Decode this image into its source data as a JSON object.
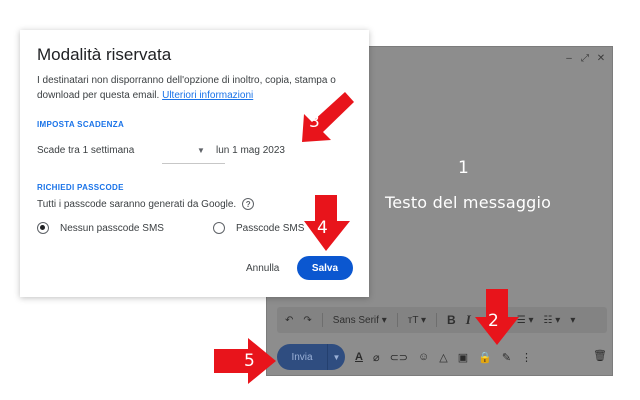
{
  "dialog": {
    "title": "Modalità riservata",
    "description": "I destinatari non disporranno dell'opzione di inoltro, copia, stampa o download per questa email.",
    "link": "Ulteriori informazioni",
    "expiry_section": "IMPOSTA SCADENZA",
    "expiry_value": "Scade tra 1 settimana",
    "expiry_date": "lun 1 mag 2023",
    "passcode_section": "RICHIEDI PASSCODE",
    "passcode_desc": "Tutti i passcode saranno generati da Google.",
    "radio_no_sms": "Nessun passcode SMS",
    "radio_sms": "Passcode SMS",
    "radio_selected": "Nessun passcode SMS",
    "cancel_label": "Annulla",
    "save_label": "Salva"
  },
  "compose": {
    "body_text": "Testo del messaggio",
    "font_name": "Sans Serif",
    "send_label": "Invia"
  },
  "annotations": {
    "n1": "1",
    "n2": "2",
    "n3": "3",
    "n4": "4",
    "n5": "5"
  },
  "colors": {
    "accent": "#1a73e8",
    "save_button": "#0b57d0",
    "arrow": "#e8141b",
    "overlay_gray": "#8d8d8d"
  },
  "icons": [
    "minimize-icon",
    "expand-icon",
    "close-icon",
    "undo-icon",
    "redo-icon",
    "text-size-icon",
    "bold-icon",
    "italic-icon",
    "align-icon",
    "list-icon",
    "text-color-icon",
    "attach-icon",
    "link-icon",
    "emoji-icon",
    "drive-icon",
    "photo-icon",
    "confidential-lock-icon",
    "signature-pen-icon",
    "more-options-icon",
    "trash-icon",
    "help-icon"
  ]
}
